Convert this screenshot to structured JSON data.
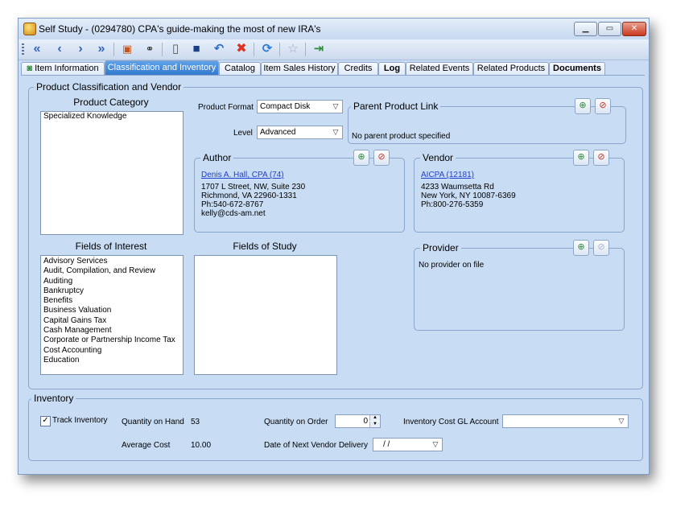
{
  "window": {
    "title": "Self Study - (0294780) CPA's guide-making the most of new IRA's"
  },
  "toolbar_icons": [
    "first-icon",
    "previous-icon",
    "next-icon",
    "last-icon",
    "book-icon",
    "view-icon",
    "new-icon",
    "save-icon",
    "undo-icon",
    "delete-icon",
    "refresh-icon",
    "favorite-icon",
    "exit-icon"
  ],
  "tabs": [
    {
      "label": "Item Information"
    },
    {
      "label": "Classification and Inventory"
    },
    {
      "label": "Catalog"
    },
    {
      "label": "Item Sales History"
    },
    {
      "label": "Credits"
    },
    {
      "label": "Log"
    },
    {
      "label": "Related Events"
    },
    {
      "label": "Related Products"
    },
    {
      "label": "Documents"
    }
  ],
  "classification": {
    "group_label": "Product Classification and Vendor",
    "product_category_heading": "Product Category",
    "product_categories": [
      "Specialized Knowledge"
    ],
    "product_format_label": "Product Format",
    "product_format_value": "Compact Disk",
    "level_label": "Level",
    "level_value": "Advanced",
    "parent_link": {
      "label": "Parent Product Link",
      "text": "No parent product specified"
    },
    "author": {
      "label": "Author",
      "link": "Denis A. Hall, CPA (74)",
      "lines": [
        "1707 L Street, NW, Suite 230",
        "Richmond, VA  22960-1331",
        "Ph:540-672-8767",
        "kelly@cds-am.net"
      ]
    },
    "vendor": {
      "label": "Vendor",
      "link": "AICPA (12181)",
      "lines": [
        "4233 Waumsetta Rd",
        "New York, NY  10087-6369",
        "Ph:800-276-5359"
      ]
    },
    "provider": {
      "label": "Provider",
      "text": "No provider on file"
    },
    "fields_of_interest_heading": "Fields of Interest",
    "fields_of_interest": [
      "Advisory Services",
      "Audit, Compilation, and Review",
      "Auditing",
      "Bankruptcy",
      "Benefits",
      "Business Valuation",
      "Capital Gains Tax",
      "Cash Management",
      "Corporate or Partnership Income Tax",
      "Cost Accounting",
      "Education"
    ],
    "fields_of_study_heading": "Fields of Study",
    "fields_of_study": []
  },
  "inventory": {
    "group_label": "Inventory",
    "track_label": "Track Inventory",
    "track_checked": true,
    "qoh_label": "Quantity on Hand",
    "qoh_value": "53",
    "qoo_label": "Quantity on Order",
    "qoo_value": "0",
    "gl_label": "Inventory Cost GL Account",
    "gl_value": "",
    "avg_cost_label": "Average Cost",
    "avg_cost_value": "10.00",
    "next_delivery_label": "Date of Next Vendor Delivery",
    "next_delivery_value": "/      /"
  }
}
